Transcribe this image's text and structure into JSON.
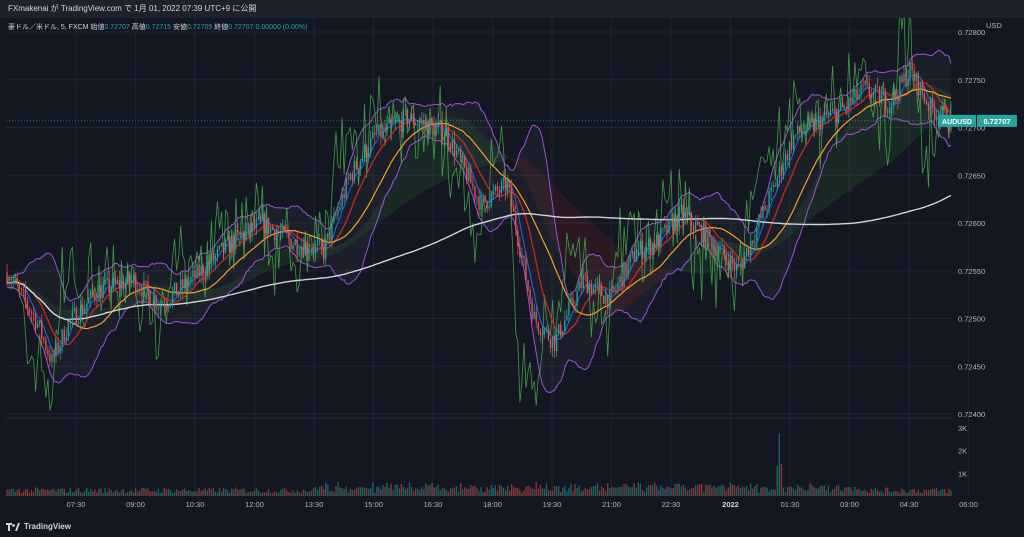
{
  "header": {
    "text": "FXmakenai が TradingView.com で 1月 01, 2022 07:39 UTC+9 に公開"
  },
  "legend": {
    "symbol": "豪ドル／米ドル, 5, FXCM",
    "open_label": "始値",
    "open": "0.72707",
    "high_label": "高値",
    "high": "0.72715",
    "low_label": "安値",
    "low": "0.72705",
    "close_label": "終値",
    "close": "0.72707",
    "change": "0.00000 (0.00%)"
  },
  "footer": {
    "brand": "TradingView"
  },
  "colors": {
    "background": "#131722",
    "up": "#26a69a",
    "down": "#ef5350",
    "grid": "#1f2433",
    "bollinger": "#9c52d6",
    "rsi_like": "#4caf50",
    "ma_fast": "#2962ff",
    "ma_mid": "#c62828",
    "ma_slow": "#f4a020",
    "ma_long": "#d1d4dc",
    "price_tag": "#26a69a"
  },
  "chart_data": {
    "type": "candlestick",
    "symbol": "AUDUSD",
    "currency_label": "USD",
    "last_price": "0.72707",
    "price_tag_label": "AUDUSD",
    "ylim": [
      0.724,
      0.728
    ],
    "y_ticks": [
      "0.72800",
      "0.72750",
      "0.72700",
      "0.72650",
      "0.72600",
      "0.72550",
      "0.72500",
      "0.72450",
      "0.72400"
    ],
    "x_ticks": [
      "07:30",
      "09:00",
      "10:30",
      "12:00",
      "13:30",
      "15:00",
      "16:30",
      "18:00",
      "19:30",
      "21:00",
      "22:30",
      "2022",
      "01:30",
      "03:00",
      "04:30",
      "06:00"
    ],
    "x_bold_tick": "2022",
    "volume_ticks": [
      "3K",
      "2K",
      "1K"
    ],
    "volume_ylim": [
      0,
      3000
    ],
    "price_keyframes": [
      [
        0,
        0.72548
      ],
      [
        14,
        0.725
      ],
      [
        22,
        0.72455
      ],
      [
        30,
        0.72495
      ],
      [
        45,
        0.7253
      ],
      [
        62,
        0.7254
      ],
      [
        75,
        0.72515
      ],
      [
        90,
        0.7254
      ],
      [
        110,
        0.7258
      ],
      [
        125,
        0.726
      ],
      [
        140,
        0.7258
      ],
      [
        155,
        0.7257
      ],
      [
        168,
        0.7265
      ],
      [
        180,
        0.7269
      ],
      [
        196,
        0.7271
      ],
      [
        215,
        0.72695
      ],
      [
        232,
        0.7262
      ],
      [
        245,
        0.7264
      ],
      [
        258,
        0.725
      ],
      [
        268,
        0.72475
      ],
      [
        282,
        0.7254
      ],
      [
        295,
        0.7252
      ],
      [
        308,
        0.7257
      ],
      [
        318,
        0.7258
      ],
      [
        330,
        0.7261
      ],
      [
        345,
        0.7258
      ],
      [
        358,
        0.7255
      ],
      [
        372,
        0.7262
      ],
      [
        385,
        0.7269
      ],
      [
        400,
        0.7271
      ],
      [
        410,
        0.7272
      ],
      [
        420,
        0.7274
      ],
      [
        432,
        0.72725
      ],
      [
        442,
        0.7276
      ],
      [
        452,
        0.7272
      ],
      [
        462,
        0.72707
      ]
    ],
    "volume_spike_index": 378,
    "volume_spike_value": 2750,
    "series": [
      {
        "kind": "bollinger_band"
      },
      {
        "kind": "moving_average_fast"
      },
      {
        "kind": "moving_average_mid"
      },
      {
        "kind": "moving_average_slow"
      },
      {
        "kind": "moving_average_long"
      },
      {
        "kind": "oscillator_overlay"
      }
    ]
  }
}
